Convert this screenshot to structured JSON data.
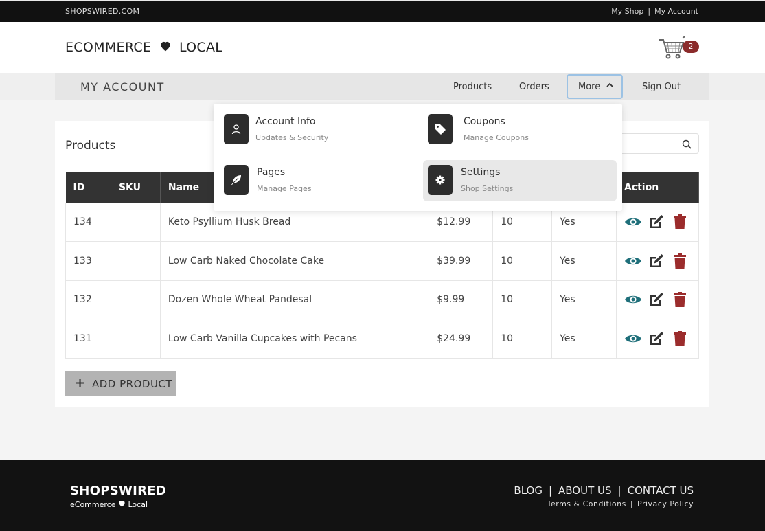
{
  "topbar": {
    "site": "SHOPSWIRED.COM",
    "my_shop": "My Shop",
    "separator": "|",
    "my_account": "My Account"
  },
  "header": {
    "logo_left": "ECOMMERCE",
    "logo_right": "LOCAL",
    "cart_count": "2"
  },
  "account_bar": {
    "title": "MY ACCOUNT",
    "nav": {
      "products": "Products",
      "orders": "Orders",
      "more": "More",
      "sign_out": "Sign Out"
    }
  },
  "dropdown": {
    "items": [
      {
        "title": "Account Info",
        "subtitle": "Updates & Security",
        "icon": "user-icon"
      },
      {
        "title": "Coupons",
        "subtitle": "Manage Coupons",
        "icon": "tag-icon"
      },
      {
        "title": "Pages",
        "subtitle": "Manage Pages",
        "icon": "feather-icon"
      },
      {
        "title": "Settings",
        "subtitle": "Shop Settings",
        "icon": "gear-icon"
      }
    ]
  },
  "products": {
    "title": "Products",
    "columns": [
      "ID",
      "SKU",
      "Name",
      "",
      "",
      "",
      "Action"
    ],
    "rows": [
      {
        "id": "134",
        "sku": "",
        "name": "Keto Psyllium Husk Bread",
        "price": "$12.99",
        "qty": "10",
        "active": "Yes"
      },
      {
        "id": "133",
        "sku": "",
        "name": "Low Carb Naked Chocolate Cake",
        "price": "$39.99",
        "qty": "10",
        "active": "Yes"
      },
      {
        "id": "132",
        "sku": "",
        "name": "Dozen Whole Wheat Pandesal",
        "price": "$9.99",
        "qty": "10",
        "active": "Yes"
      },
      {
        "id": "131",
        "sku": "",
        "name": "Low Carb Vanilla Cupcakes with Pecans",
        "price": "$24.99",
        "qty": "10",
        "active": "Yes"
      }
    ],
    "add_button": "ADD PRODUCT"
  },
  "footer": {
    "brand": "SHOPSWIRED",
    "tagline_left": "eCommerce",
    "tagline_right": "Local",
    "links": [
      "BLOG",
      "ABOUT US",
      "CONTACT US"
    ],
    "separator": "|",
    "legal": [
      "Terms & Conditions",
      "Privacy Policy"
    ]
  },
  "colors": {
    "dark": "#333333",
    "teal": "#1f6f7a",
    "red": "#9b2c2c",
    "badge": "#8b2b2b",
    "focus": "#9cc2e4"
  }
}
